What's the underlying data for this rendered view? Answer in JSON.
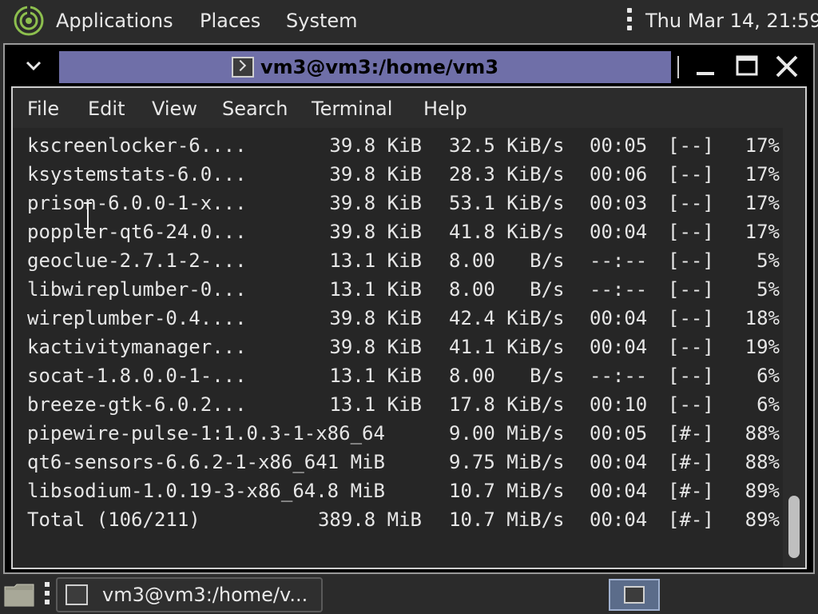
{
  "top_panel": {
    "menus": [
      "Applications",
      "Places",
      "System"
    ],
    "clock": "Thu Mar 14, 21:59"
  },
  "window": {
    "title": "vm3@vm3:/home/vm3",
    "menubar": [
      "File",
      "Edit",
      "View",
      "Search",
      "Terminal",
      "Help"
    ]
  },
  "terminal": {
    "rows": [
      {
        "name": "kscreenlocker-6....",
        "size": "39.8 KiB",
        "rate": "32.5 KiB/s",
        "eta": "00:05",
        "bar": "[--]",
        "pct": "17%"
      },
      {
        "name": "ksystemstats-6.0...",
        "size": "39.8 KiB",
        "rate": "28.3 KiB/s",
        "eta": "00:06",
        "bar": "[--]",
        "pct": "17%"
      },
      {
        "name": "prison-6.0.0-1-x...",
        "size": "39.8 KiB",
        "rate": "53.1 KiB/s",
        "eta": "00:03",
        "bar": "[--]",
        "pct": "17%"
      },
      {
        "name": "poppler-qt6-24.0...",
        "size": "39.8 KiB",
        "rate": "41.8 KiB/s",
        "eta": "00:04",
        "bar": "[--]",
        "pct": "17%"
      },
      {
        "name": "geoclue-2.7.1-2-...",
        "size": "13.1 KiB",
        "rate": "8.00   B/s",
        "eta": "--:--",
        "bar": "[--]",
        "pct": "5%"
      },
      {
        "name": "libwireplumber-0...",
        "size": "13.1 KiB",
        "rate": "8.00   B/s",
        "eta": "--:--",
        "bar": "[--]",
        "pct": "5%"
      },
      {
        "name": "wireplumber-0.4....",
        "size": "39.8 KiB",
        "rate": "42.4 KiB/s",
        "eta": "00:04",
        "bar": "[--]",
        "pct": "18%"
      },
      {
        "name": "kactivitymanager...",
        "size": "39.8 KiB",
        "rate": "41.1 KiB/s",
        "eta": "00:04",
        "bar": "[--]",
        "pct": "19%"
      },
      {
        "name": "socat-1.8.0.0-1-...",
        "size": "13.1 KiB",
        "rate": "8.00   B/s",
        "eta": "--:--",
        "bar": "[--]",
        "pct": "6%"
      },
      {
        "name": "breeze-gtk-6.0.2...",
        "size": "13.1 KiB",
        "rate": "17.8 KiB/s",
        "eta": "00:10",
        "bar": "[--]",
        "pct": "6%"
      },
      {
        "name": "pipewire-pulse-1:1.0.3-1-x86_64",
        "size": "",
        "rate": "9.00 MiB/s",
        "eta": "00:05",
        "bar": "[#-]",
        "pct": "88%"
      },
      {
        "name": "qt6-sensors-6.6.2-1-x86_641 MiB",
        "size": "",
        "rate": "9.75 MiB/s",
        "eta": "00:04",
        "bar": "[#-]",
        "pct": "88%"
      },
      {
        "name": "libsodium-1.0.19-3-x86_64.8 MiB",
        "size": "",
        "rate": "10.7 MiB/s",
        "eta": "00:04",
        "bar": "[#-]",
        "pct": "89%"
      },
      {
        "name": "Total (106/211)",
        "size": "389.8 MiB",
        "rate": "10.7 MiB/s",
        "eta": "00:04",
        "bar": "[#-]",
        "pct": "89%"
      }
    ]
  },
  "taskbar": {
    "task_label": "vm3@vm3:/home/v..."
  },
  "icons": {
    "logo": "distro-logo-icon",
    "window_menu": "chevron-down-icon",
    "minimize": "minimize-icon",
    "maximize": "maximize-icon",
    "close": "close-icon",
    "terminal": "terminal-icon",
    "show_desktop": "show-desktop-icon",
    "text_cursor": "text-cursor-icon"
  },
  "colors": {
    "title_field": "#6f6fa8",
    "logo_green": "#8dbf4e",
    "pager": "#5b6c8a"
  }
}
